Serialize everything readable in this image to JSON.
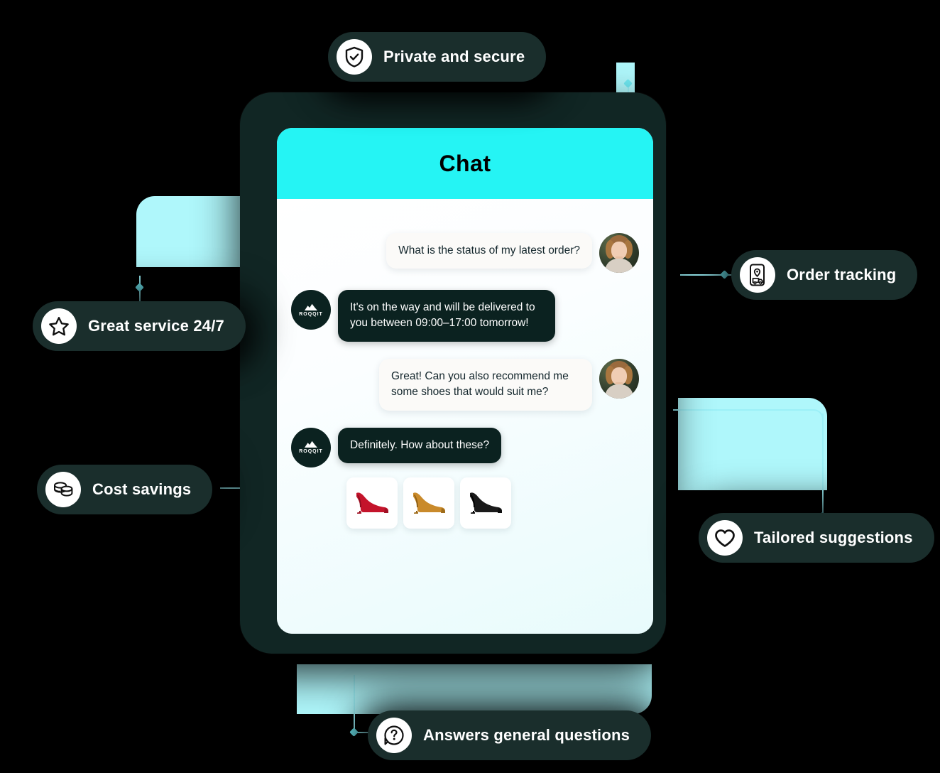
{
  "device": {
    "name": "tablet-device"
  },
  "chat": {
    "header_title": "Chat",
    "messages": [
      {
        "sender": "user",
        "text": "What is the status of my latest order?",
        "avatar": "customer-photo-avatar"
      },
      {
        "sender": "bot",
        "text": "It's on the way and will be delivered to you between 09:00–17:00 tomorrow!",
        "avatar": "roqqit-logo-avatar",
        "avatar_label": "ROQQIT"
      },
      {
        "sender": "user",
        "text": "Great! Can you also recommend me some shoes that would suit me?",
        "avatar": "customer-photo-avatar"
      },
      {
        "sender": "bot",
        "text": "Definitely. How about these?",
        "avatar": "roqqit-logo-avatar",
        "avatar_label": "ROQQIT"
      }
    ],
    "products": [
      {
        "name": "red-high-heel",
        "color": "#C4142B"
      },
      {
        "name": "tan-high-heel",
        "color": "#C98A2B"
      },
      {
        "name": "black-high-heel",
        "color": "#1A1A1A"
      }
    ]
  },
  "badges": [
    {
      "id": "private-and-secure",
      "label": "Private and secure",
      "icon": "shield-check-icon"
    },
    {
      "id": "great-service",
      "label": "Great service 24/7",
      "icon": "star-icon"
    },
    {
      "id": "cost-savings",
      "label": "Cost savings",
      "icon": "coins-icon"
    },
    {
      "id": "order-tracking",
      "label": "Order tracking",
      "icon": "phone-tracking-icon"
    },
    {
      "id": "tailored-suggestions",
      "label": "Tailored suggestions",
      "icon": "heart-icon"
    },
    {
      "id": "answers-questions",
      "label": "Answers general questions",
      "icon": "question-bubble-icon"
    }
  ],
  "colors": {
    "accent_cyan": "#25F4F4",
    "soft_cyan": "#AFF7FB",
    "badge_dark": "#1A2E2C",
    "bot_bubble": "#0B2220",
    "user_bubble": "#FBFAF8",
    "background": "#000000"
  }
}
